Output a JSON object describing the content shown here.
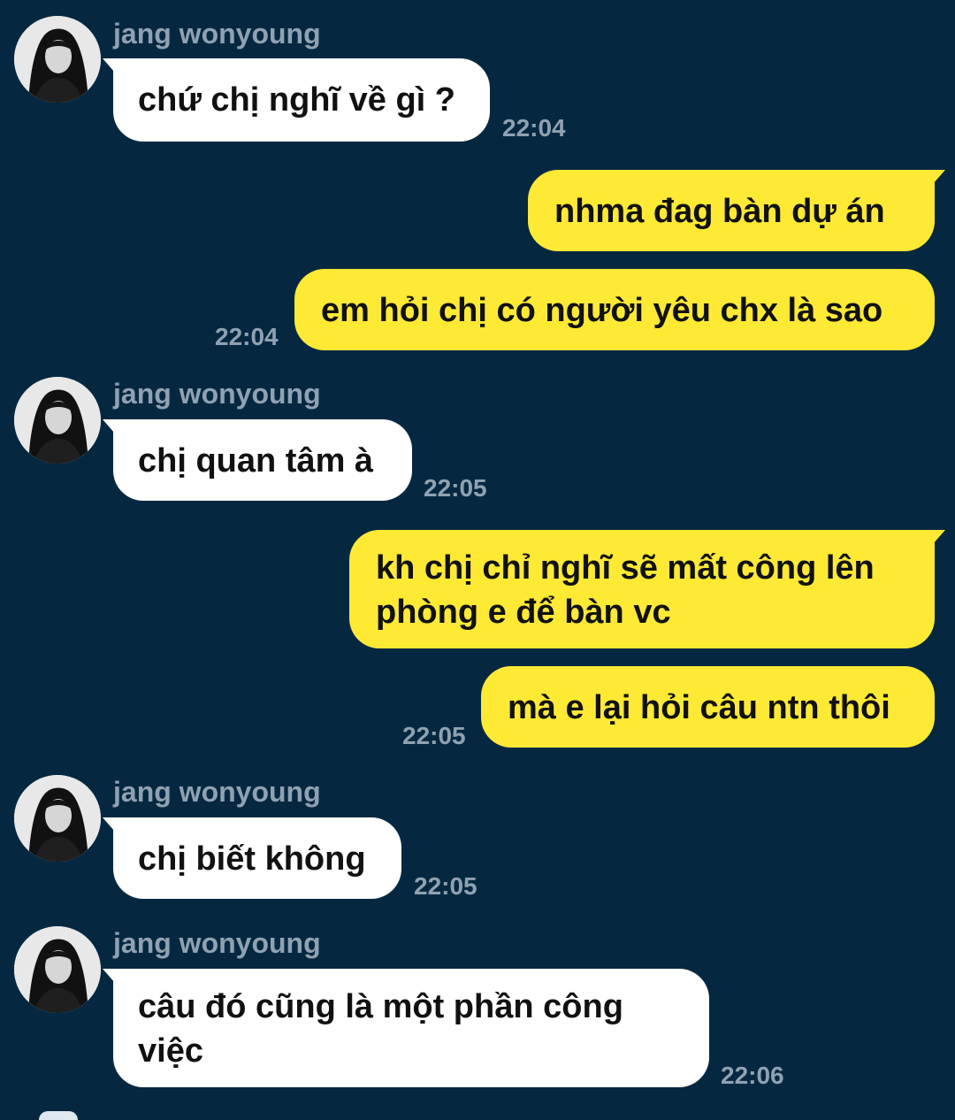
{
  "chat": {
    "contact_name": "jang wonyoung",
    "messages": [
      {
        "id": 1,
        "direction": "in",
        "text": "chứ chị nghĩ về gì ?",
        "time": "22:04"
      },
      {
        "id": 2,
        "direction": "out",
        "text": "nhma đag bàn dự án",
        "time": ""
      },
      {
        "id": 3,
        "direction": "out",
        "text": "em hỏi chị có người yêu chx là sao",
        "time": "22:04"
      },
      {
        "id": 4,
        "direction": "in",
        "text": "chị quan tâm à",
        "time": "22:05"
      },
      {
        "id": 5,
        "direction": "out",
        "text": "kh chị chỉ nghĩ sẽ mất công lên phòng e để bàn vc",
        "time": ""
      },
      {
        "id": 6,
        "direction": "out",
        "text": "mà e lại hỏi câu ntn thôi",
        "time": "22:05"
      },
      {
        "id": 7,
        "direction": "in",
        "text": "chị biết không",
        "time": "22:05"
      },
      {
        "id": 8,
        "direction": "in",
        "text": "câu đó cũng là một phần công việc",
        "time": "22:06"
      }
    ]
  },
  "colors": {
    "background": "#052840",
    "incoming_bubble": "#ffffff",
    "outgoing_bubble": "#fee935",
    "meta_text": "#8fa1b2",
    "message_text": "#111111"
  },
  "icons": {
    "avatar": "profile-photo"
  }
}
